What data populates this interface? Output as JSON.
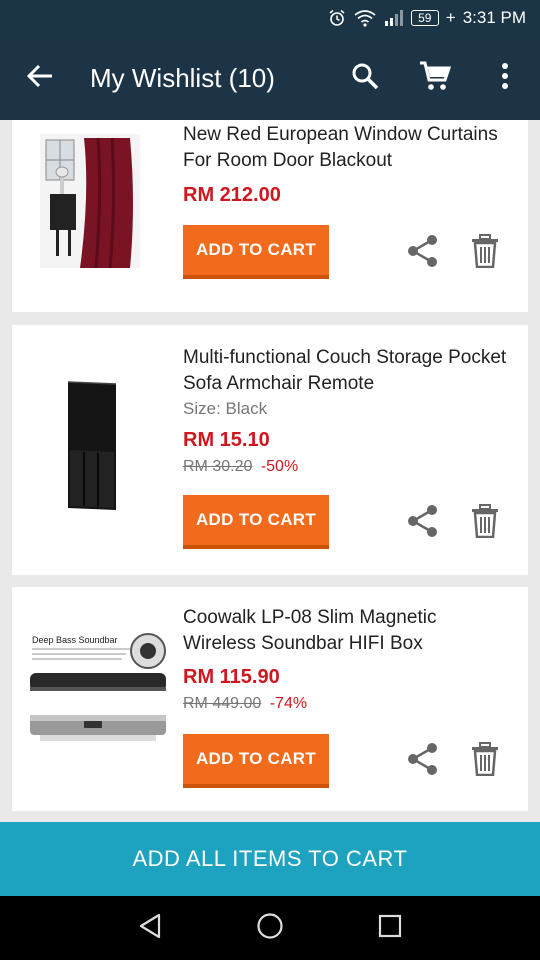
{
  "status_bar": {
    "battery": "59",
    "time": "3:31 PM",
    "icons": [
      "alarm-icon",
      "wifi-icon",
      "signal-icon",
      "battery-icon"
    ]
  },
  "app_bar": {
    "title": "My Wishlist (10)",
    "icons": [
      "back-arrow-icon",
      "search-icon",
      "cart-icon",
      "more-vert-icon"
    ]
  },
  "items": [
    {
      "name": "New Red European Window Curtains For Room Door Blackout",
      "price": "RM 212.00",
      "add_to_cart": "ADD TO CART"
    },
    {
      "name": "Multi-functional Couch Storage Pocket Sofa Armchair Remote",
      "variant": "Size: Black",
      "price": "RM 15.10",
      "original_price": "RM 30.20",
      "discount": "-50%",
      "add_to_cart": "ADD TO CART"
    },
    {
      "name": "Coowalk LP-08 Slim Magnetic Wireless Soundbar HIFI Box",
      "price": "RM 115.90",
      "original_price": "RM 449.00",
      "discount": "-74%",
      "add_to_cart": "ADD TO CART",
      "image_text": "Deep Bass Soundbar"
    }
  ],
  "add_all_label": "ADD ALL ITEMS TO CART",
  "nav_bar": {
    "icons": [
      "back-triangle-icon",
      "home-circle-icon",
      "recents-square-icon"
    ]
  },
  "colors": {
    "app_bar": "#1d3446",
    "price_red": "#d0161e",
    "add_to_cart_orange": "#f26a1b",
    "add_all_teal": "#1da2bf"
  }
}
